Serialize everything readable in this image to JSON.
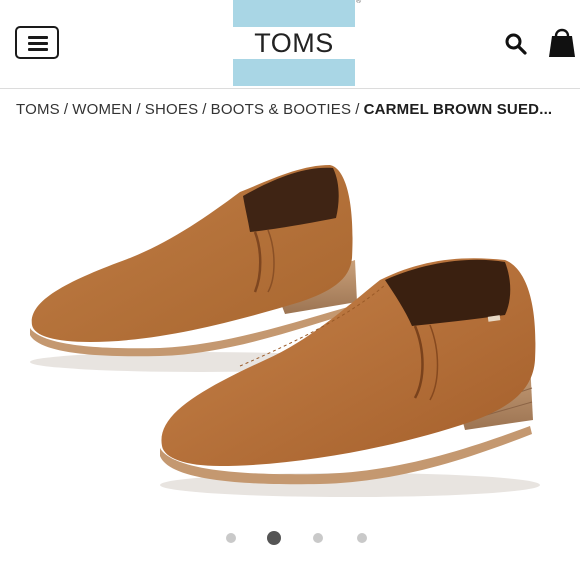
{
  "header": {
    "logo_text": "TOMS",
    "logo_mark": "®",
    "menu_icon": "hamburger-menu-icon",
    "search_icon": "search-icon",
    "bag_icon": "shopping-bag-icon",
    "colors": {
      "brand_blue": "#a9d6e5"
    }
  },
  "breadcrumb": {
    "items": [
      "TOMS",
      "WOMEN",
      "SHOES",
      "BOOTS & BOOTIES"
    ],
    "separator": "/",
    "current": "CARMEL BROWN SUED..."
  },
  "product": {
    "image_icon": "shoe-photo",
    "colors": {
      "suede": "#b8753f",
      "sole": "#c49870"
    }
  },
  "carousel": {
    "count": 4,
    "active_index": 1
  }
}
